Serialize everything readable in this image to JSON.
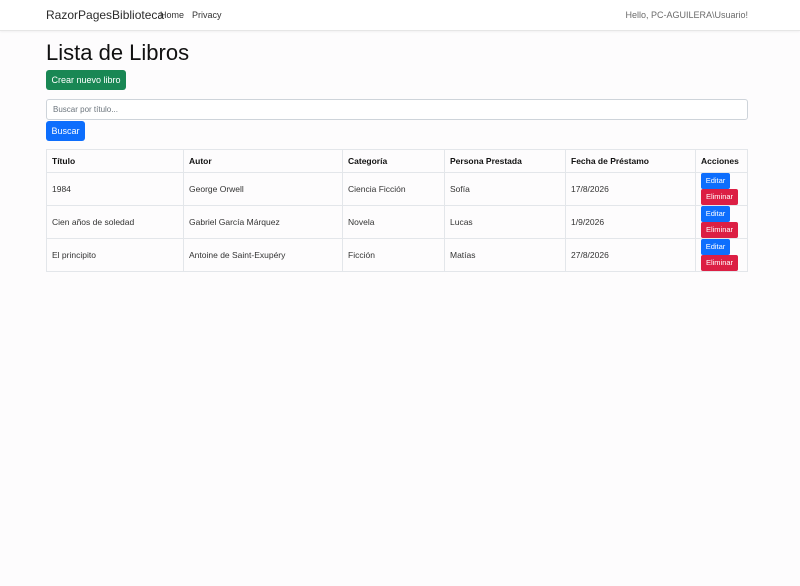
{
  "navbar": {
    "brand": "RazorPagesBiblioteca",
    "links": [
      "Home",
      "Privacy"
    ],
    "greeting": "Hello, PC-AGUILERA\\Usuario!"
  },
  "main": {
    "title": "Lista de Libros",
    "create_button": "Crear nuevo libro",
    "search": {
      "placeholder": "Buscar por título...",
      "value": ""
    },
    "search_button": "Buscar"
  },
  "table": {
    "headers": [
      "Título",
      "Autor",
      "Categoría",
      "Persona Prestada",
      "Fecha de Préstamo",
      "Acciones"
    ],
    "rows": [
      [
        "1984",
        "George Orwell",
        "Ciencia Ficción",
        "Sofía",
        "17/8/2026"
      ],
      [
        "Cien años de soledad",
        "Gabriel García Márquez",
        "Novela",
        "Lucas",
        "1/9/2026"
      ],
      [
        "El principito",
        "Antoine de Saint-Exupéry",
        "Ficción",
        "Matías",
        "27/8/2026"
      ]
    ],
    "edit_label": "Editar",
    "delete_label": "Eliminar"
  },
  "colors": {
    "create": "#198754",
    "primary": "#0d6efd",
    "danger": "#dc1f44"
  }
}
